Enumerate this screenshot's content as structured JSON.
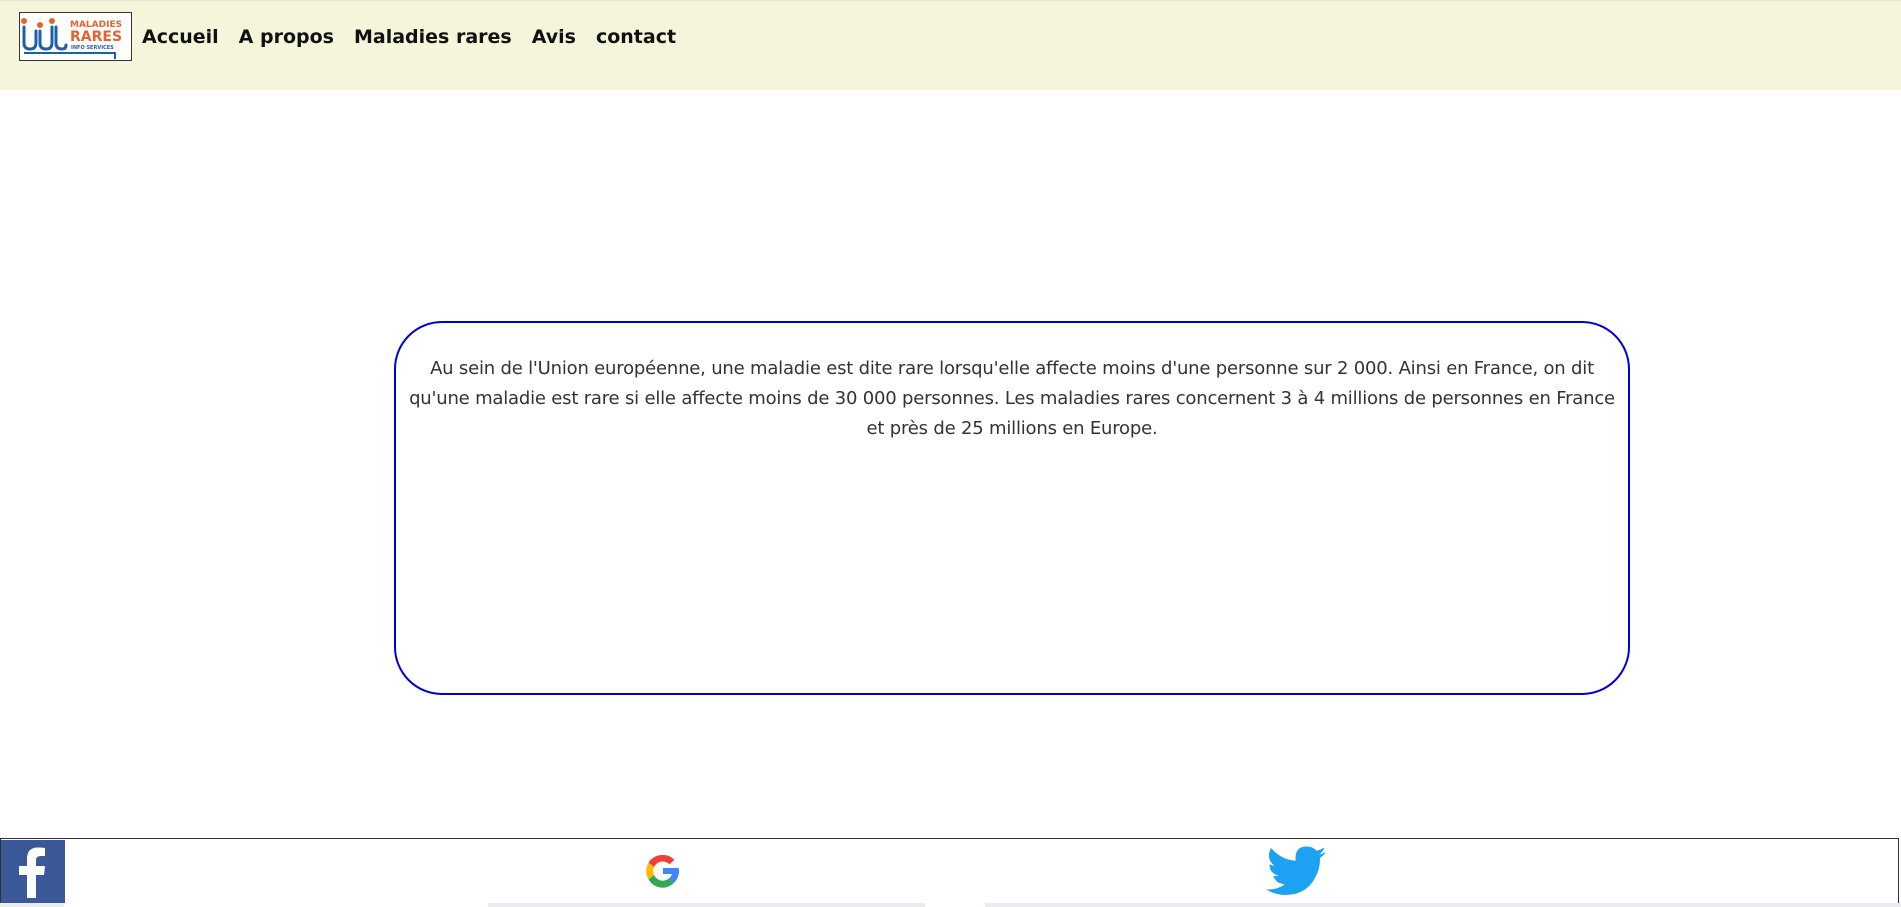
{
  "header": {
    "logo": {
      "line1": "MALADIES",
      "line2": "RARES",
      "line3": "INFO SERVICES"
    },
    "nav": [
      {
        "label": "Accueil"
      },
      {
        "label": "A propos"
      },
      {
        "label": "Maladies rares"
      },
      {
        "label": "Avis"
      },
      {
        "label": "contact"
      }
    ]
  },
  "main": {
    "info_text": "Au sein de l'Union européenne, une maladie est dite rare lorsqu'elle affecte moins d'une personne sur 2 000. Ainsi en France, on dit qu'une maladie est rare si elle affecte moins de 30 000 personnes. Les maladies rares concernent 3 à 4 millions de personnes en France et près de 25 millions en Europe."
  },
  "footer": {
    "social": [
      {
        "icon": "facebook-icon"
      },
      {
        "icon": "google-icon"
      },
      {
        "icon": "twitter-icon"
      }
    ]
  },
  "colors": {
    "header_bg": "#f5f5dc",
    "box_border": "#0000dd",
    "facebook": "#3b5998",
    "twitter": "#1da1f2",
    "logo_blue": "#1f5fa8",
    "logo_orange": "#e8632b"
  }
}
